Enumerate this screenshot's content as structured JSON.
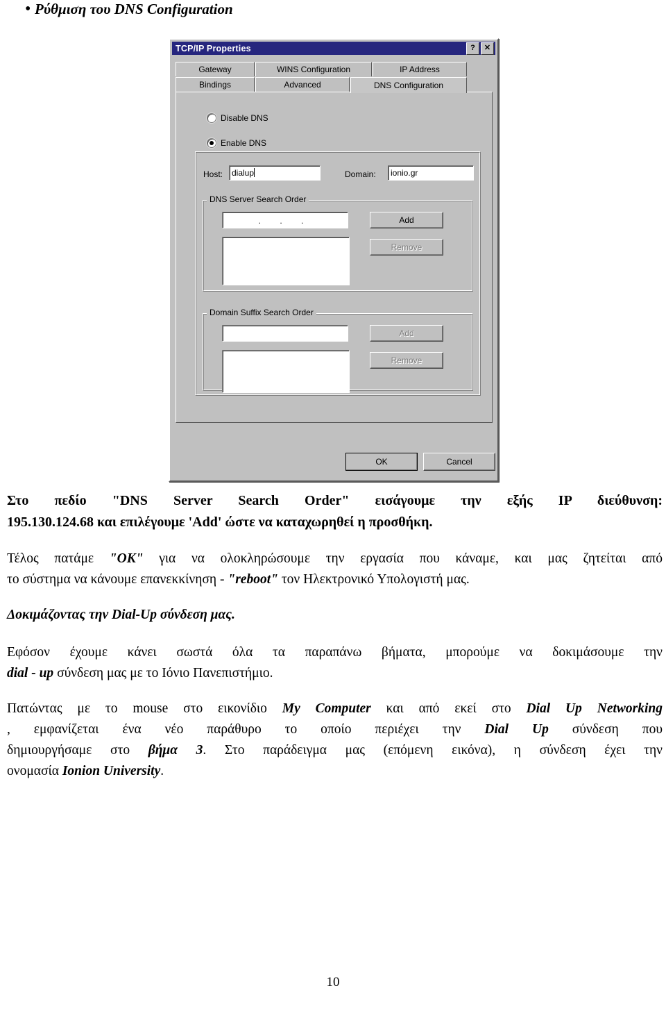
{
  "bullet": {
    "marker": "•",
    "text": "Ρύθμιση του DNS Configuration"
  },
  "dialog": {
    "title": "TCP/IP Properties",
    "help_button": "?",
    "close_button": "✕",
    "tabs_row1": [
      "Gateway",
      "WINS Configuration",
      "IP Address"
    ],
    "tabs_row2": [
      "Bindings",
      "Advanced",
      "DNS Configuration"
    ],
    "active_tab": "DNS Configuration",
    "radios": [
      {
        "label": "Disable DNS",
        "checked": false
      },
      {
        "label": "Enable DNS",
        "checked": true
      }
    ],
    "host_label": "Host:",
    "host_value": "dialup",
    "domain_label": "Domain:",
    "domain_value": "ionio.gr",
    "dns_group_title": "DNS Server Search Order",
    "dns_input_value": ". . .",
    "dns_add_button": "Add",
    "dns_remove_button": "Remove",
    "suffix_group_title": "Domain Suffix Search Order",
    "suffix_input_value": "",
    "suffix_add_button": "Add",
    "suffix_remove_button": "Remove",
    "ok_button": "OK",
    "cancel_button": "Cancel"
  },
  "body": {
    "p1_line1": "Στο πεδίο \"DNS Server Search Order\" εισάγουμε την εξής IP διεύθυνση:",
    "p1_line2": "195.130.124.68 και επιλέγουμε 'Add' ώστε να καταχωρηθεί η προσθήκη.",
    "p2_line1_a": "Τέλος πατάμε ",
    "p2_line1_b": "\"OK\"",
    "p2_line1_c": " για να ολοκληρώσουμε την εργασία που κάναμε, και μας ζητείται από",
    "p2_line2_a": "το σύστημα να κάνουμε επανεκκίνηση - ",
    "p2_line2_b": "\"reboot\"",
    "p2_line2_c": " τον Ηλεκτρονικό Υπολογιστή μας.",
    "p3": "Δοκιμάζοντας την Dial-Up σύνδεση μας.",
    "p4_line1": "Εφόσον έχουμε κάνει σωστά όλα τα παραπάνω βήματα, μπορούμε να δοκιμάσουμε την",
    "p4_line2_a": "dial - up",
    "p4_line2_b": " σύνδεση μας με το Ιόνιο Πανεπιστήμιο.",
    "p5_line1_a": "Πατώντας με το mouse στο εικονίδιο ",
    "p5_line1_b": "My Computer",
    "p5_line1_c": " και από εκεί στο ",
    "p5_line1_d": "Dial Up Networking",
    "p5_line2_a": ", εμφανίζεται ένα νέο παράθυρο το οποίο περιέχει την ",
    "p5_line2_b": "Dial Up",
    "p5_line2_c": " σύνδεση που",
    "p5_line3_a": "δημιουργήσαμε στο ",
    "p5_line3_b": "βήμα 3",
    "p5_line3_c": ". Στο παράδειγμα μας (επόμενη εικόνα), η σύνδεση έχει την",
    "p5_line4_a": "ονομασία ",
    "p5_line4_b": "Ionion University",
    "p5_line4_c": "."
  },
  "page_number": "10"
}
